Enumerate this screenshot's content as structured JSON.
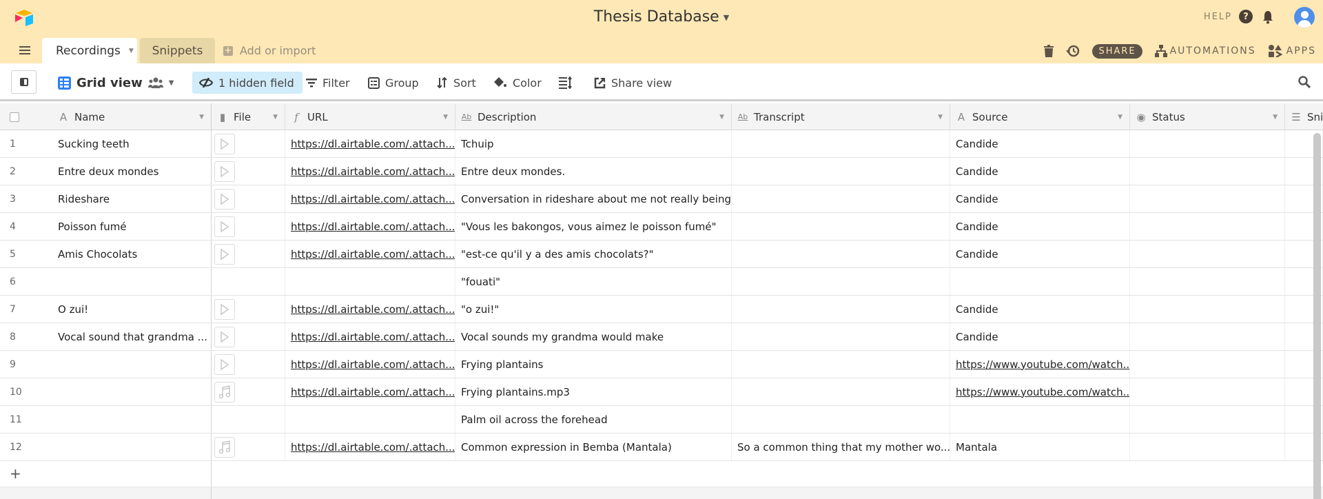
{
  "app": {
    "title": "Thesis Database",
    "help_label": "HELP",
    "colors": {
      "header_bg": "#fde8b6",
      "accent": "#2d7ff9",
      "hidden_field_bg": "#d1ecfa"
    }
  },
  "tabs": [
    {
      "label": "Recordings",
      "active": true
    },
    {
      "label": "Snippets",
      "active": false
    }
  ],
  "add_import_label": "Add or import",
  "right_actions": {
    "share": "SHARE",
    "automations": "AUTOMATIONS",
    "apps": "APPS"
  },
  "toolbar": {
    "view_name": "Grid view",
    "hidden_field": "1 hidden field",
    "filter": "Filter",
    "group": "Group",
    "sort": "Sort",
    "color": "Color",
    "share_view": "Share view"
  },
  "columns": [
    {
      "label": "Name",
      "icon": "text-field-icon"
    },
    {
      "label": "File",
      "icon": "attachment-icon"
    },
    {
      "label": "URL",
      "icon": "formula-icon"
    },
    {
      "label": "Description",
      "icon": "long-text-icon"
    },
    {
      "label": "Transcript",
      "icon": "long-text-icon"
    },
    {
      "label": "Source",
      "icon": "text-field-icon"
    },
    {
      "label": "Status",
      "icon": "single-select-icon"
    },
    {
      "label": "Sni",
      "icon": "lookup-icon"
    }
  ],
  "rows": [
    {
      "n": "1",
      "name": "Sucking teeth",
      "file": "video",
      "url": "https://dl.airtable.com/.attach...",
      "description": "Tchuip",
      "transcript": "",
      "source": "Candide",
      "source_link": false,
      "status": ""
    },
    {
      "n": "2",
      "name": "Entre deux mondes",
      "file": "video",
      "url": "https://dl.airtable.com/.attach...",
      "description": "Entre deux mondes.",
      "transcript": "",
      "source": "Candide",
      "source_link": false,
      "status": ""
    },
    {
      "n": "3",
      "name": "Rideshare",
      "file": "video",
      "url": "https://dl.airtable.com/.attach...",
      "description": "Conversation in rideshare about me not really being...",
      "transcript": "",
      "source": "Candide",
      "source_link": false,
      "status": ""
    },
    {
      "n": "4",
      "name": "Poisson fumé",
      "file": "video",
      "url": "https://dl.airtable.com/.attach...",
      "description": "\"Vous les bakongos, vous aimez le poisson fumé\"",
      "transcript": "",
      "source": "Candide",
      "source_link": false,
      "status": ""
    },
    {
      "n": "5",
      "name": "Amis Chocolats",
      "file": "video",
      "url": "https://dl.airtable.com/.attach...",
      "description": "\"est-ce qu'il y a des amis chocolats?\"",
      "transcript": "",
      "source": "Candide",
      "source_link": false,
      "status": ""
    },
    {
      "n": "6",
      "name": "",
      "file": "",
      "url": "",
      "description": "\"fouati\"",
      "transcript": "",
      "source": "",
      "source_link": false,
      "status": ""
    },
    {
      "n": "7",
      "name": "O zui!",
      "file": "video",
      "url": "https://dl.airtable.com/.attach...",
      "description": "\"o zui!\"",
      "transcript": "",
      "source": "Candide",
      "source_link": false,
      "status": ""
    },
    {
      "n": "8",
      "name": "Vocal sound that grandma ...",
      "file": "video",
      "url": "https://dl.airtable.com/.attach...",
      "description": "Vocal sounds my grandma would make",
      "transcript": "",
      "source": "Candide",
      "source_link": false,
      "status": ""
    },
    {
      "n": "9",
      "name": "",
      "file": "video",
      "url": "https://dl.airtable.com/.attach...",
      "description": "Frying plantains",
      "transcript": "",
      "source": "https://www.youtube.com/watch...",
      "source_link": true,
      "status": ""
    },
    {
      "n": "10",
      "name": "",
      "file": "audio",
      "url": "https://dl.airtable.com/.attach...",
      "description": "Frying plantains.mp3",
      "transcript": "",
      "source": "https://www.youtube.com/watch...",
      "source_link": true,
      "status": ""
    },
    {
      "n": "11",
      "name": "",
      "file": "",
      "url": "",
      "description": "Palm oil across the forehead",
      "transcript": "",
      "source": "",
      "source_link": false,
      "status": ""
    },
    {
      "n": "12",
      "name": "",
      "file": "audio",
      "url": "https://dl.airtable.com/.attach...",
      "description": "Common expression in Bemba (Mantala)",
      "transcript": "So a common thing that my mother wo...",
      "source": "Mantala",
      "source_link": false,
      "status": ""
    }
  ],
  "add_row_label": "+"
}
